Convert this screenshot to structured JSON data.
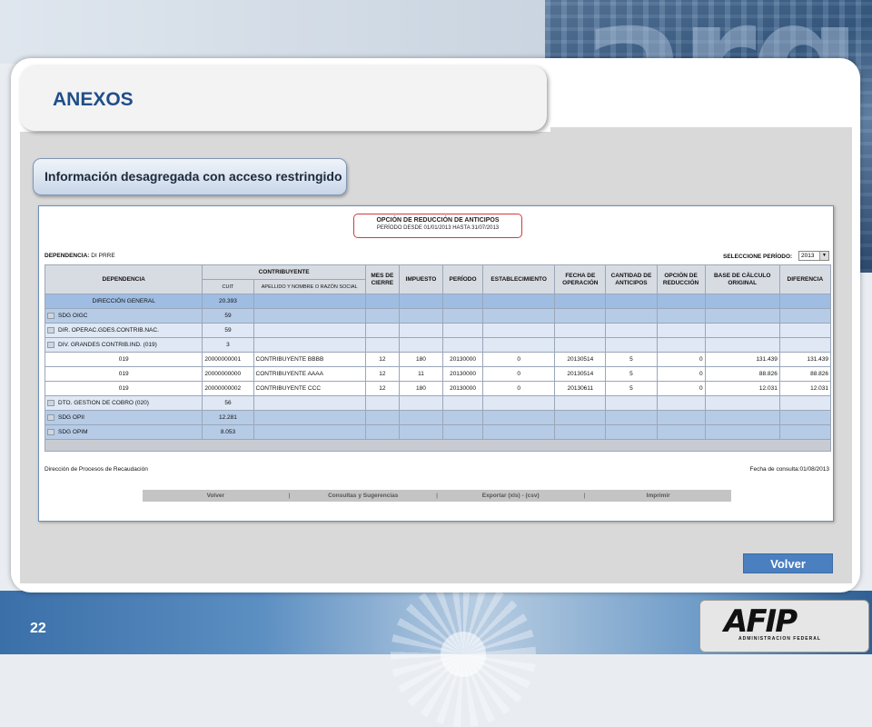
{
  "header": {
    "title": "ANEXOS",
    "brand_overlay": "arg"
  },
  "section": {
    "label": "Información desagregada con acceso restringido"
  },
  "report": {
    "title": "OPCIÓN DE REDUCCIÓN DE ANTICIPOS",
    "subtitle": "PERÍODO DESDE 01/01/2013 HASTA 31/07/2013",
    "dependencia_label": "DEPENDENCIA:",
    "dependencia_value": "DI PRRE",
    "period_label": "SELECCIONE PERÍODO:",
    "period_value": "2013",
    "columns": {
      "dependencia": "DEPENDENCIA",
      "contribuyente": "CONTRIBUYENTE",
      "cuit": "CUIT",
      "razon": "APELLIDO Y NOMBRE O RAZÓN SOCIAL",
      "mes_cierre": "MES DE CIERRE",
      "impuesto": "IMPUESTO",
      "periodo": "PERÍODO",
      "establecimiento": "ESTABLECIMIENTO",
      "fecha": "FECHA DE OPERACIÓN",
      "cantidad": "CANTIDAD DE ANTICIPOS",
      "opcion": "OPCIÓN DE REDUCCIÓN",
      "base": "BASE DE CÁLCULO ORIGINAL",
      "diferencia": "DIFERENCIA"
    },
    "direccion_general": {
      "name": "DIRECCIÓN GENERAL",
      "count": "20.393"
    },
    "rows": [
      {
        "name": "SDG OIGC",
        "count": "59"
      },
      {
        "name": "DIR. OPERAC.GDES.CONTRIB.NAC.",
        "count": "59"
      },
      {
        "name": "DIV. GRANDES CONTRIB.IND. (019)",
        "count": "3"
      }
    ],
    "details": [
      {
        "dep": "019",
        "cuit": "20000000001",
        "razon": "CONTRIBUYENTE BBBB",
        "mes": "12",
        "imp": "180",
        "per": "20130000",
        "est": "0",
        "fecha": "20130514",
        "cant": "5",
        "opc": "0",
        "base": "131.439",
        "dif": "131.439"
      },
      {
        "dep": "019",
        "cuit": "20000000000",
        "razon": "CONTRIBUYENTE AAAA",
        "mes": "12",
        "imp": "11",
        "per": "20130000",
        "est": "0",
        "fecha": "20130514",
        "cant": "5",
        "opc": "0",
        "base": "88.826",
        "dif": "88.826"
      },
      {
        "dep": "019",
        "cuit": "20000000002",
        "razon": "CONTRIBUYENTE CCC",
        "mes": "12",
        "imp": "180",
        "per": "20130000",
        "est": "0",
        "fecha": "20130611",
        "cant": "5",
        "opc": "0",
        "base": "12.031",
        "dif": "12.031"
      }
    ],
    "rows_after": [
      {
        "name": "DTO. GESTION DE COBRO (020)",
        "count": "56"
      },
      {
        "name": "SDG OPII",
        "count": "12.281"
      },
      {
        "name": "SDG OPIM",
        "count": "8.053"
      }
    ],
    "footer_left": "Dirección de Procesos de Recaudación",
    "footer_right": "Fecha de consulta:01/08/2013",
    "actions": {
      "volver": "Volver",
      "consultas": "Consultas y Sugerencias",
      "exportar": "Exportar (xls) - (csv)",
      "imprimir": "Imprimir",
      "separator": "|"
    }
  },
  "volver_button": "Volver",
  "page_number": "22",
  "logo": {
    "name": "AFIP",
    "subtitle": "ADMINISTRACION FEDERAL"
  },
  "colors": {
    "accent": "#4a7fc0",
    "title": "#1f4e8a",
    "report_border": "#d23c3c"
  },
  "icons": {
    "expand": "plus-square-icon",
    "dropdown": "dropdown-arrow-icon"
  }
}
